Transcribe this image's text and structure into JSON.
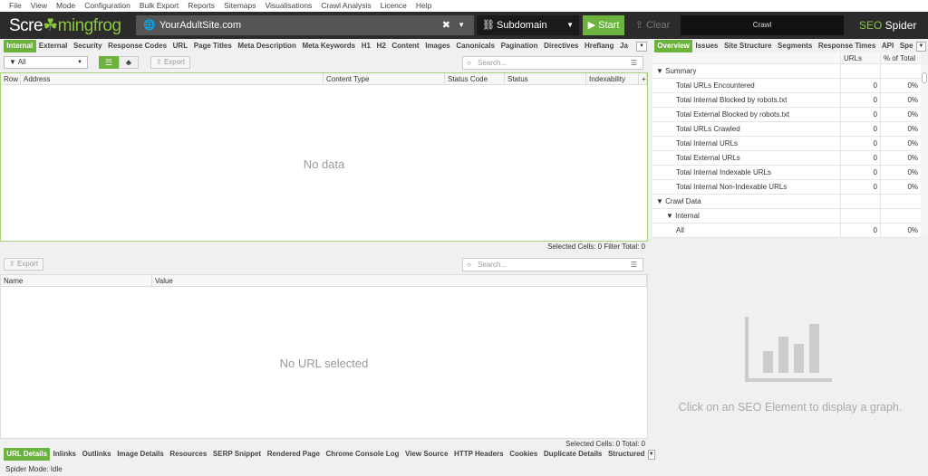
{
  "menu": [
    "File",
    "View",
    "Mode",
    "Configuration",
    "Bulk Export",
    "Reports",
    "Sitemaps",
    "Visualisations",
    "Crawl Analysis",
    "Licence",
    "Help"
  ],
  "header": {
    "logo_a": "Scre",
    "logo_b": "mingfrog",
    "url": "YourAdultSite.com",
    "mode": "Subdomain",
    "start": "Start",
    "clear": "Clear",
    "crawl": "Crawl",
    "brand_a": "SEO",
    "brand_b": " Spider"
  },
  "tabs": [
    "Internal",
    "External",
    "Security",
    "Response Codes",
    "URL",
    "Page Titles",
    "Meta Description",
    "Meta Keywords",
    "H1",
    "H2",
    "Content",
    "Images",
    "Canonicals",
    "Pagination",
    "Directives",
    "Hreflang",
    "Ja"
  ],
  "toolbar": {
    "filter": "All",
    "export": "Export",
    "search_placeholder": "Search..."
  },
  "columns": [
    "Row",
    "Address",
    "Content Type",
    "Status Code",
    "Status",
    "Indexability"
  ],
  "main_empty": "No data",
  "main_status": "Selected Cells:  0  Filter Total:  0",
  "lower": {
    "export": "Export",
    "search_placeholder": "Search...",
    "columns": [
      "Name",
      "Value"
    ],
    "empty": "No URL selected",
    "status": "Selected Cells:  0  Total:  0"
  },
  "bottom_tabs": [
    "URL Details",
    "Inlinks",
    "Outlinks",
    "Image Details",
    "Resources",
    "SERP Snippet",
    "Rendered Page",
    "Chrome Console Log",
    "View Source",
    "HTTP Headers",
    "Cookies",
    "Duplicate Details",
    "Structured"
  ],
  "statusbar": "Spider Mode: Idle",
  "right": {
    "tabs": [
      "Overview",
      "Issues",
      "Site Structure",
      "Segments",
      "Response Times",
      "API",
      "Spe"
    ],
    "columns": [
      "URLs",
      "% of Total"
    ],
    "rows": [
      {
        "name": "Summary",
        "level": 0,
        "group": true
      },
      {
        "name": "Total URLs Encountered",
        "level": 2,
        "urls": "0",
        "pct": "0%"
      },
      {
        "name": "Total Internal Blocked by robots.txt",
        "level": 2,
        "urls": "0",
        "pct": "0%"
      },
      {
        "name": "Total External Blocked by robots.txt",
        "level": 2,
        "urls": "0",
        "pct": "0%"
      },
      {
        "name": "Total URLs Crawled",
        "level": 2,
        "urls": "0",
        "pct": "0%"
      },
      {
        "name": "Total Internal URLs",
        "level": 2,
        "urls": "0",
        "pct": "0%"
      },
      {
        "name": "Total External URLs",
        "level": 2,
        "urls": "0",
        "pct": "0%"
      },
      {
        "name": "Total Internal Indexable URLs",
        "level": 2,
        "urls": "0",
        "pct": "0%"
      },
      {
        "name": "Total Internal Non-Indexable URLs",
        "level": 2,
        "urls": "0",
        "pct": "0%"
      },
      {
        "name": "Crawl Data",
        "level": 0,
        "group": true
      },
      {
        "name": "Internal",
        "level": 1,
        "group": true
      },
      {
        "name": "All",
        "level": 2,
        "urls": "0",
        "pct": "0%"
      }
    ],
    "graph_hint": "Click on an SEO Element to display a graph."
  },
  "colors": {
    "accent": "#6cb33e",
    "header": "#2b2b2b"
  }
}
